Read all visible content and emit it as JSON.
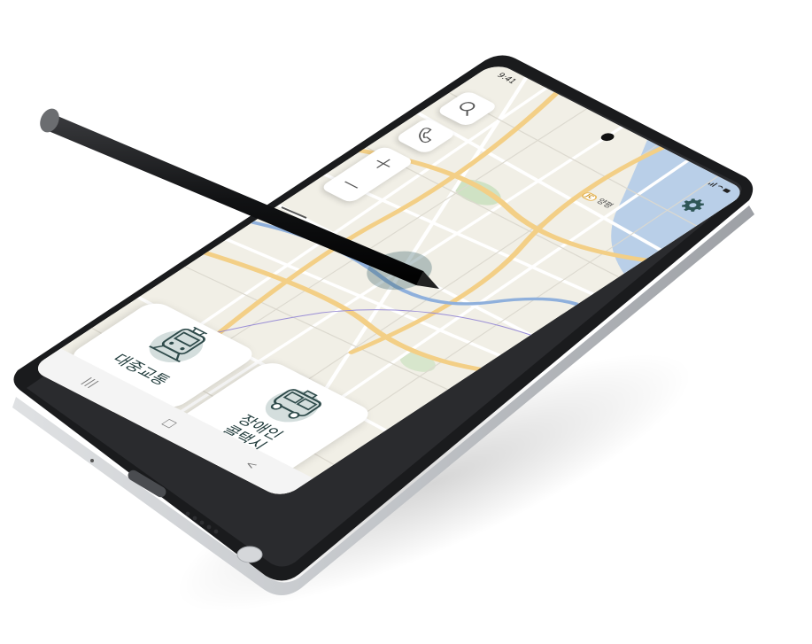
{
  "status_bar": {
    "time": "9:41",
    "signal_icons": "signal-wifi-battery"
  },
  "map": {
    "junction_badge": "JC",
    "junction_label": "양평"
  },
  "buttons": {
    "search": {
      "icon": "search-icon"
    },
    "call": {
      "icon": "phone-icon"
    },
    "zoom_in": {
      "icon": "plus-icon"
    },
    "zoom_out": {
      "icon": "minus-icon"
    },
    "locate": {
      "icon": "crosshair-icon"
    },
    "settings": {
      "icon": "gear-icon"
    }
  },
  "cards": {
    "public_transport": {
      "label": "대중교통",
      "icon": "train-icon"
    },
    "disabled_taxi": {
      "label_line1": "장애인",
      "label_line2": "콜택시",
      "icon": "taxi-icon"
    }
  },
  "navigation": {
    "recent": "|||",
    "home": "□",
    "back": "<"
  },
  "colors": {
    "accent": "#2f5656",
    "card_icon_bg": "#d4dedd",
    "water": "#b9cfe8",
    "road": "#f3cf86"
  }
}
